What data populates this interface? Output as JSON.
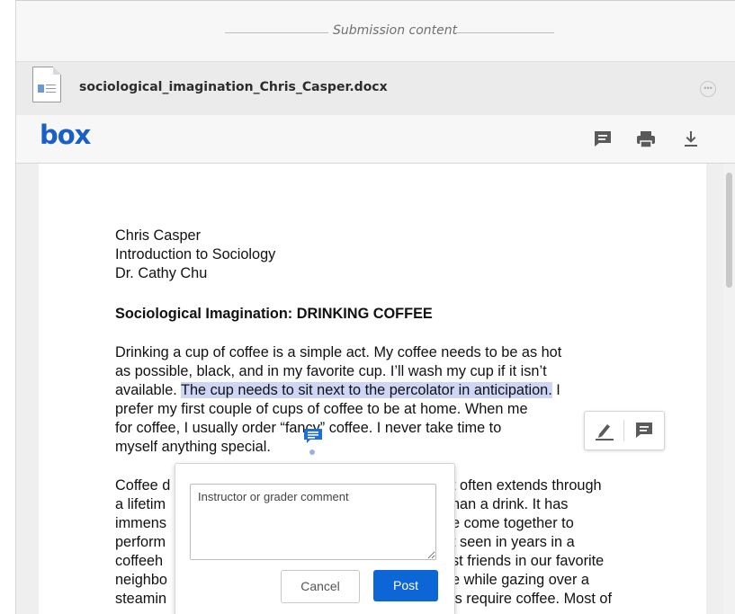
{
  "submission_header": {
    "title": "Submission content"
  },
  "file": {
    "name": "sociological_imagination_Chris_Casper.docx",
    "more_icon": "ellipsis-circle-icon"
  },
  "viewer_bar": {
    "logo": "box",
    "actions": [
      {
        "name": "comment-toggle",
        "icon": "comment-icon"
      },
      {
        "name": "print",
        "icon": "print-icon"
      },
      {
        "name": "download",
        "icon": "download-icon"
      }
    ]
  },
  "document": {
    "author": "Chris Casper",
    "course": "Introduction to Sociology",
    "instructor": "Dr. Cathy Chu",
    "title": "Sociological Imagination: DRINKING COFFEE",
    "paragraph1": {
      "line1": "Drinking a cup of coffee is a simple act. My coffee needs to be as hot",
      "line2": "as possible, black, and in my favorite cup. I’ll wash my cup if it isn’t",
      "line3_before": "available. ",
      "line3_highlight": "The cup needs to sit next to the percolator in anticipation.",
      "line3_after": " I",
      "line4": "prefer my first couple of cups of coffee to be at home. When me",
      "line5": "for coffee, I usually order “fancy” coffee. I never take time to",
      "line6": "myself anything special."
    },
    "paragraph2_left": [
      "Coffee d",
      "a lifetim",
      "immens",
      "perform",
      "coffeeh",
      "neighbo",
      "steamin"
    ],
    "paragraph2_right": [
      "t often extends through",
      "han a drink. It has",
      "e come together to",
      "t seen in years in a",
      "st friends in our favorite",
      "e while gazing over a",
      "ls require coffee. Most of"
    ]
  },
  "annotation_toolbar": {
    "highlight_icon": "highlighter-icon",
    "comment_icon": "comment-icon"
  },
  "comment_popup": {
    "placeholder": "Instructor or grader comment",
    "cancel_label": "Cancel",
    "post_label": "Post"
  },
  "colors": {
    "accent": "#0d66d6",
    "box_logo": "#1a5fc3",
    "highlight": "#cfd6f5"
  }
}
